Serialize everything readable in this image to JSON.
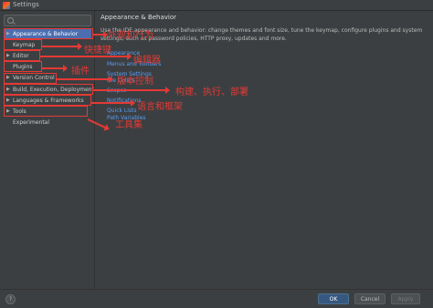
{
  "window": {
    "title": "Settings"
  },
  "sidebar": {
    "items": [
      {
        "label": "Appearance & Behavior",
        "arrow": "▶",
        "selected": true
      },
      {
        "label": "Keymap",
        "arrow": ""
      },
      {
        "label": "Editor",
        "arrow": "▶"
      },
      {
        "label": "Plugins",
        "arrow": ""
      },
      {
        "label": "Version Control",
        "arrow": "▶"
      },
      {
        "label": "Build, Execution, Deployment",
        "arrow": "▶"
      },
      {
        "label": "Languages & Frameworks",
        "arrow": "▶"
      },
      {
        "label": "Tools",
        "arrow": "▶"
      },
      {
        "label": "Experimental",
        "arrow": ""
      }
    ]
  },
  "main": {
    "heading": "Appearance & Behavior",
    "description": "Use the IDE appearance and behavior: change themes and font size, tune the keymap, configure plugins and system settings, such as password policies, HTTP proxy, updates and more.",
    "links": [
      "Appearance",
      "Menus and Toolbars",
      "System Settings",
      "File Colors",
      "Scopes",
      "Notifications",
      "Quick Lists",
      "Path Variables"
    ]
  },
  "buttons": {
    "help": "?",
    "ok": "OK",
    "cancel": "Cancel",
    "apply": "Apply"
  },
  "annotations": [
    "外观和行为",
    "快捷键",
    "编辑器",
    "插件",
    "版本控制",
    "构建、执行、部署",
    "语言和框架",
    "工具集"
  ],
  "colors": {
    "accent": "#4b6eaf",
    "annotation": "#e53935",
    "link": "#589df6"
  }
}
